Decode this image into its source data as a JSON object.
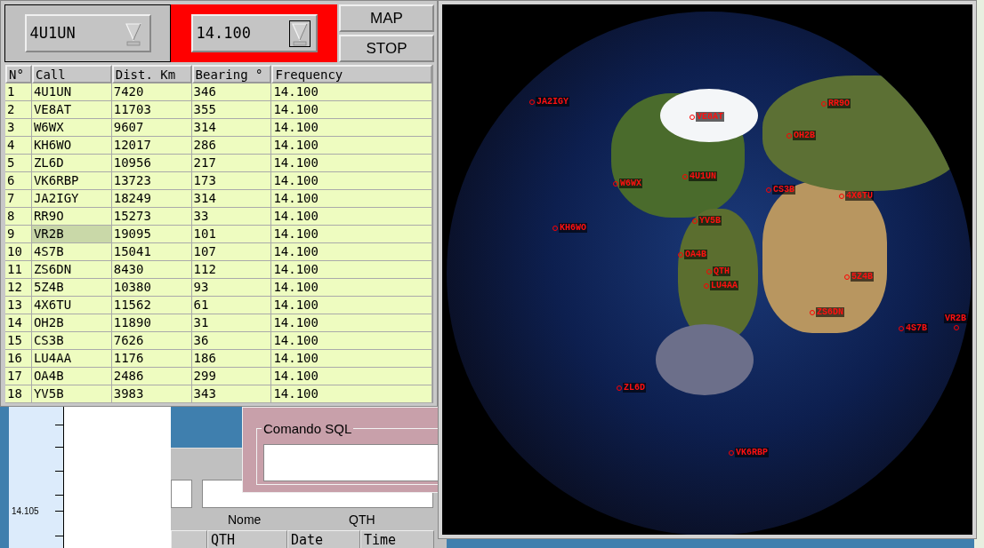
{
  "call_selector": {
    "value": "4U1UN"
  },
  "frequency_selector": {
    "value": "14.100"
  },
  "buttons": [
    "MAP",
    "STOP"
  ],
  "table": {
    "columns": [
      "N°",
      "Call",
      "Dist. Km",
      "Bearing °",
      "Frequency"
    ],
    "rows": [
      {
        "cells": [
          "1",
          "4U1UN",
          "7420",
          "346",
          "14.100"
        ],
        "call_selected": false
      },
      {
        "cells": [
          "2",
          "VE8AT",
          "11703",
          "355",
          "14.100"
        ],
        "call_selected": false
      },
      {
        "cells": [
          "3",
          "W6WX",
          "9607",
          "314",
          "14.100"
        ],
        "call_selected": false
      },
      {
        "cells": [
          "4",
          "KH6WO",
          "12017",
          "286",
          "14.100"
        ],
        "call_selected": false
      },
      {
        "cells": [
          "5",
          "ZL6D",
          "10956",
          "217",
          "14.100"
        ],
        "call_selected": false
      },
      {
        "cells": [
          "6",
          "VK6RBP",
          "13723",
          "173",
          "14.100"
        ],
        "call_selected": false
      },
      {
        "cells": [
          "7",
          "JA2IGY",
          "18249",
          "314",
          "14.100"
        ],
        "call_selected": false
      },
      {
        "cells": [
          "8",
          "RR9O",
          "15273",
          "33",
          "14.100"
        ],
        "call_selected": false
      },
      {
        "cells": [
          "9",
          "VR2B",
          "19095",
          "101",
          "14.100"
        ],
        "call_selected": true
      },
      {
        "cells": [
          "10",
          "4S7B",
          "15041",
          "107",
          "14.100"
        ],
        "call_selected": false
      },
      {
        "cells": [
          "11",
          "ZS6DN",
          "8430",
          "112",
          "14.100"
        ],
        "call_selected": false
      },
      {
        "cells": [
          "12",
          "5Z4B",
          "10380",
          "93",
          "14.100"
        ],
        "call_selected": false
      },
      {
        "cells": [
          "13",
          "4X6TU",
          "11562",
          "61",
          "14.100"
        ],
        "call_selected": false
      },
      {
        "cells": [
          "14",
          "OH2B",
          "11890",
          "31",
          "14.100"
        ],
        "call_selected": false
      },
      {
        "cells": [
          "15",
          "CS3B",
          "7626",
          "36",
          "14.100"
        ],
        "call_selected": false
      },
      {
        "cells": [
          "16",
          "LU4AA",
          "1176",
          "186",
          "14.100"
        ],
        "call_selected": false
      },
      {
        "cells": [
          "17",
          "OA4B",
          "2486",
          "299",
          "14.100"
        ],
        "call_selected": false
      },
      {
        "cells": [
          "18",
          "YV5B",
          "3983",
          "343",
          "14.100"
        ],
        "call_selected": false
      }
    ]
  },
  "map": {
    "markers": [
      {
        "label": "JA2IGY"
      },
      {
        "label": "VE8AT"
      },
      {
        "label": "RR9O"
      },
      {
        "label": "OH2B"
      },
      {
        "label": "4U1UN"
      },
      {
        "label": "W6WX"
      },
      {
        "label": "CS3B"
      },
      {
        "label": "4X6TU"
      },
      {
        "label": "YV5B"
      },
      {
        "label": "KH6WO"
      },
      {
        "label": "OA4B"
      },
      {
        "label": "QTH"
      },
      {
        "label": "LU4AA"
      },
      {
        "label": "5Z4B"
      },
      {
        "label": "ZS6DN"
      },
      {
        "label": "4S7B"
      },
      {
        "label": "VR2B"
      },
      {
        "label": "ZL6D"
      },
      {
        "label": "VK6RBP"
      }
    ]
  },
  "frequency_axis": {
    "tick_label": "14.105"
  },
  "sql_panel": {
    "legend": "Comando SQL"
  },
  "log_form": {
    "labels": [
      "Nome",
      "QTH"
    ]
  },
  "log_columns": [
    "",
    "QTH",
    "Date",
    "Time"
  ]
}
